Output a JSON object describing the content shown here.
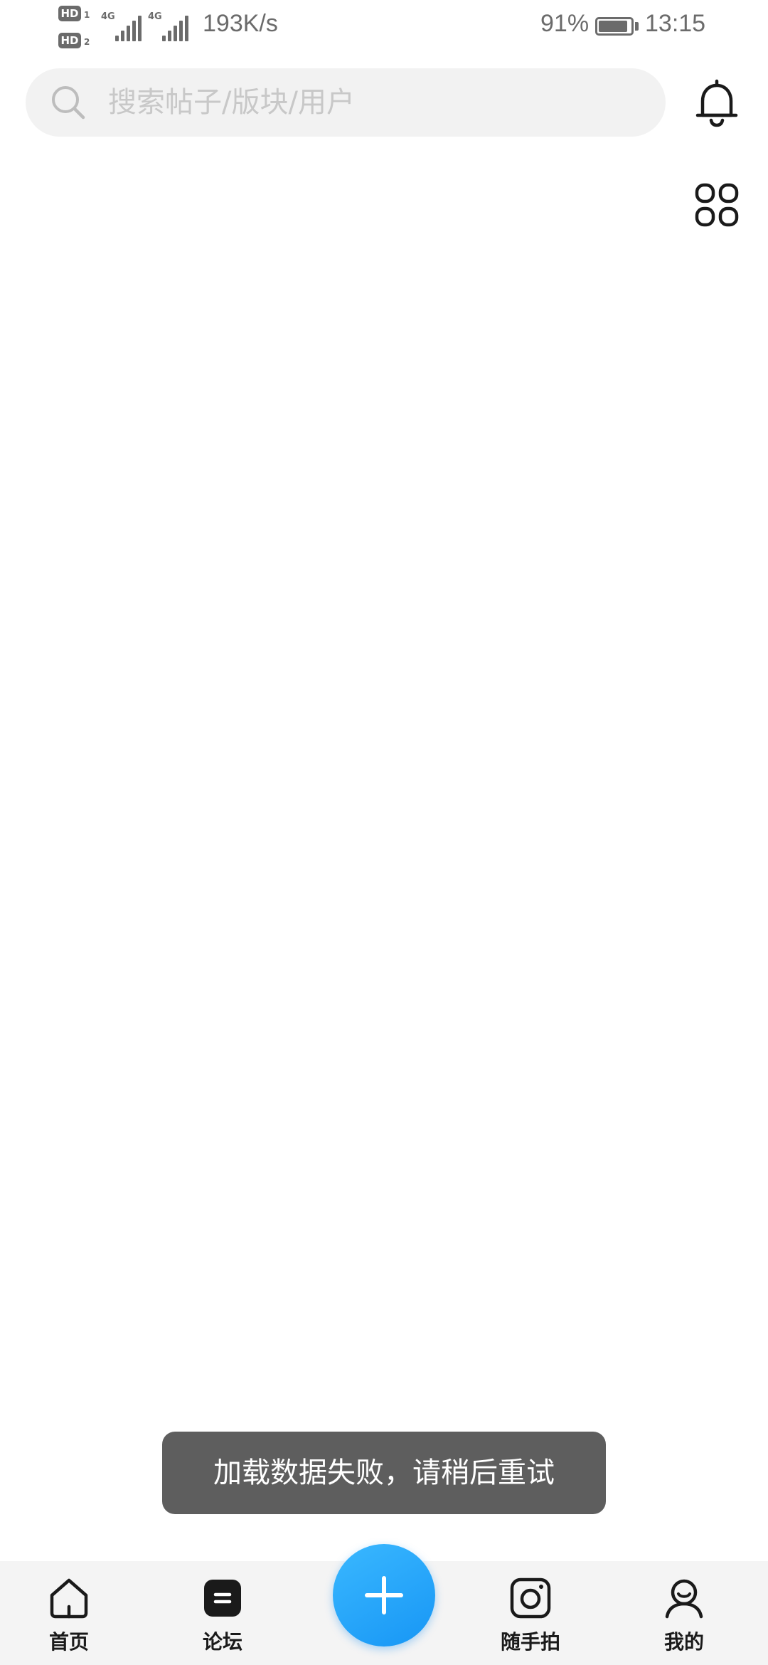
{
  "status_bar": {
    "sim1_label": "HD",
    "sim1_index": "1",
    "sim2_label": "HD",
    "sim2_index": "2",
    "network1": "4G",
    "network2": "4G",
    "net_speed": "193K/s",
    "battery_percent": "91%",
    "battery_level": 0.91,
    "time": "13:15"
  },
  "header": {
    "search_placeholder": "搜索帖子/版块/用户",
    "search_icon": "search-icon",
    "notification_icon": "bell-icon",
    "apps_icon": "grid-icon"
  },
  "toast": {
    "message": "加载数据失败，请稍后重试"
  },
  "bottom_nav": {
    "items": [
      {
        "label": "首页",
        "icon": "home-icon"
      },
      {
        "label": "论坛",
        "icon": "forum-icon"
      },
      {
        "label": "随手拍",
        "icon": "camera-icon"
      },
      {
        "label": "我的",
        "icon": "profile-icon"
      }
    ],
    "fab_icon": "plus-icon"
  },
  "colors": {
    "accent": "#1fa3ff",
    "toast_bg": "#5e5e5e",
    "nav_bg": "#f4f4f4",
    "search_bg": "#f2f2f2",
    "status_text": "#6b6b6b"
  }
}
